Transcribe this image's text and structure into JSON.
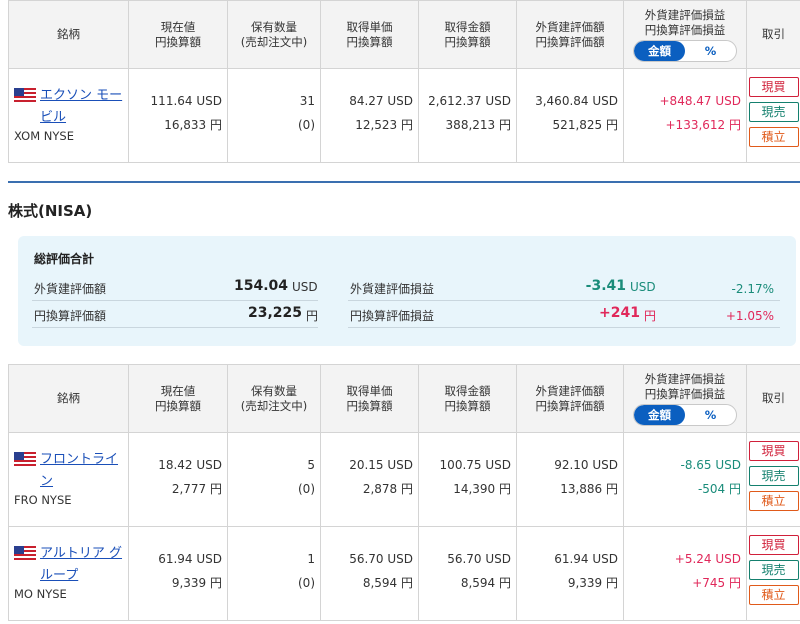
{
  "headers": {
    "name": "銘柄",
    "price": [
      "現在値",
      "円換算額"
    ],
    "qty": [
      "保有数量",
      "(売却注文中)"
    ],
    "unit_cost": [
      "取得単価",
      "円換算額"
    ],
    "cost_amount": [
      "取得金額",
      "円換算額"
    ],
    "valuation": [
      "外貨建評価額",
      "円換算評価額"
    ],
    "pnl": [
      "外貨建評価損益",
      "円換算評価損益"
    ],
    "toggle_amount": "金額",
    "toggle_percent": "%",
    "trade": "取引"
  },
  "buttons": {
    "buy": "現買",
    "sell": "現売",
    "accumulate": "積立"
  },
  "top_rows": [
    {
      "name": "エクソン モービル",
      "ticker": "XOM NYSE",
      "price_usd": "111.64 USD",
      "price_jpy": "16,833 円",
      "qty": "31",
      "qty_order": "(0)",
      "unit_cost_usd": "84.27 USD",
      "unit_cost_jpy": "12,523 円",
      "cost_usd": "2,612.37 USD",
      "cost_jpy": "388,213 円",
      "val_usd": "3,460.84 USD",
      "val_jpy": "521,825 円",
      "pnl_usd": "+848.47 USD",
      "pnl_jpy": "+133,612 円",
      "pnl_sign": "pos"
    }
  ],
  "section": {
    "title": "株式(NISA)",
    "summary": {
      "title": "総評価合計",
      "fx_valuation_label": "外貨建評価額",
      "fx_valuation_value": "154.04",
      "fx_valuation_unit": "USD",
      "jpy_valuation_label": "円換算評価額",
      "jpy_valuation_value": "23,225",
      "jpy_valuation_unit": "円",
      "fx_pnl_label": "外貨建評価損益",
      "fx_pnl_value": "-3.41",
      "fx_pnl_unit": "USD",
      "fx_pnl_pct": "-2.17%",
      "jpy_pnl_label": "円換算評価損益",
      "jpy_pnl_value": "+241",
      "jpy_pnl_unit": "円",
      "jpy_pnl_pct": "+1.05%"
    }
  },
  "nisa_rows": [
    {
      "name": "フロントライン",
      "ticker": "FRO NYSE",
      "price_usd": "18.42 USD",
      "price_jpy": "2,777 円",
      "qty": "5",
      "qty_order": "(0)",
      "unit_cost_usd": "20.15 USD",
      "unit_cost_jpy": "2,878 円",
      "cost_usd": "100.75 USD",
      "cost_jpy": "14,390 円",
      "val_usd": "92.10 USD",
      "val_jpy": "13,886 円",
      "pnl_usd": "-8.65 USD",
      "pnl_jpy": "-504 円",
      "pnl_sign": "neg"
    },
    {
      "name": "アルトリア グループ",
      "ticker": "MO NYSE",
      "price_usd": "61.94 USD",
      "price_jpy": "9,339 円",
      "qty": "1",
      "qty_order": "(0)",
      "unit_cost_usd": "56.70 USD",
      "unit_cost_jpy": "8,594 円",
      "cost_usd": "56.70 USD",
      "cost_jpy": "8,594 円",
      "val_usd": "61.94 USD",
      "val_jpy": "9,339 円",
      "pnl_usd": "+5.24 USD",
      "pnl_jpy": "+745 円",
      "pnl_sign": "pos"
    }
  ],
  "colors": {
    "positive": "#e0285a",
    "negative": "#1a8c7a",
    "link": "#1a4fb8",
    "accent": "#0b5fc0"
  }
}
